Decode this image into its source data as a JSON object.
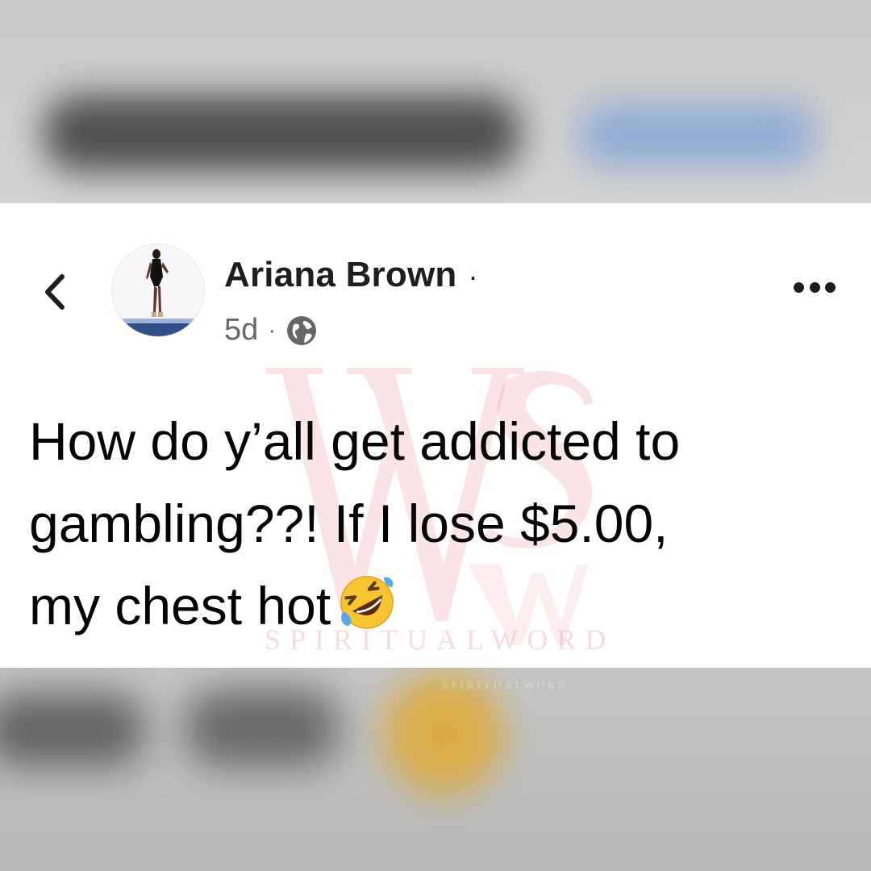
{
  "post": {
    "author_name": "Ariana Brown",
    "name_separator": "·",
    "timestamp": "5d",
    "meta_separator": "·",
    "audience_icon": "globe-icon",
    "text_lines": [
      "How do y’all get addicted to",
      "gambling??! If I lose $5.00,",
      "my chest hot"
    ],
    "emoji": "rolling-on-floor-laughing-emoji"
  },
  "navigation": {
    "back_icon": "chevron-left-icon",
    "more_icon": "more-options-icon"
  },
  "watermark": {
    "monogram": "WS",
    "label": "SPIRITUALWORD",
    "label_small": "SPIRITUALWORD"
  },
  "colors": {
    "text": "#050505",
    "secondary_text": "#65676b",
    "watermark": "#e15a64",
    "background_blur": "#cfcfcf"
  }
}
